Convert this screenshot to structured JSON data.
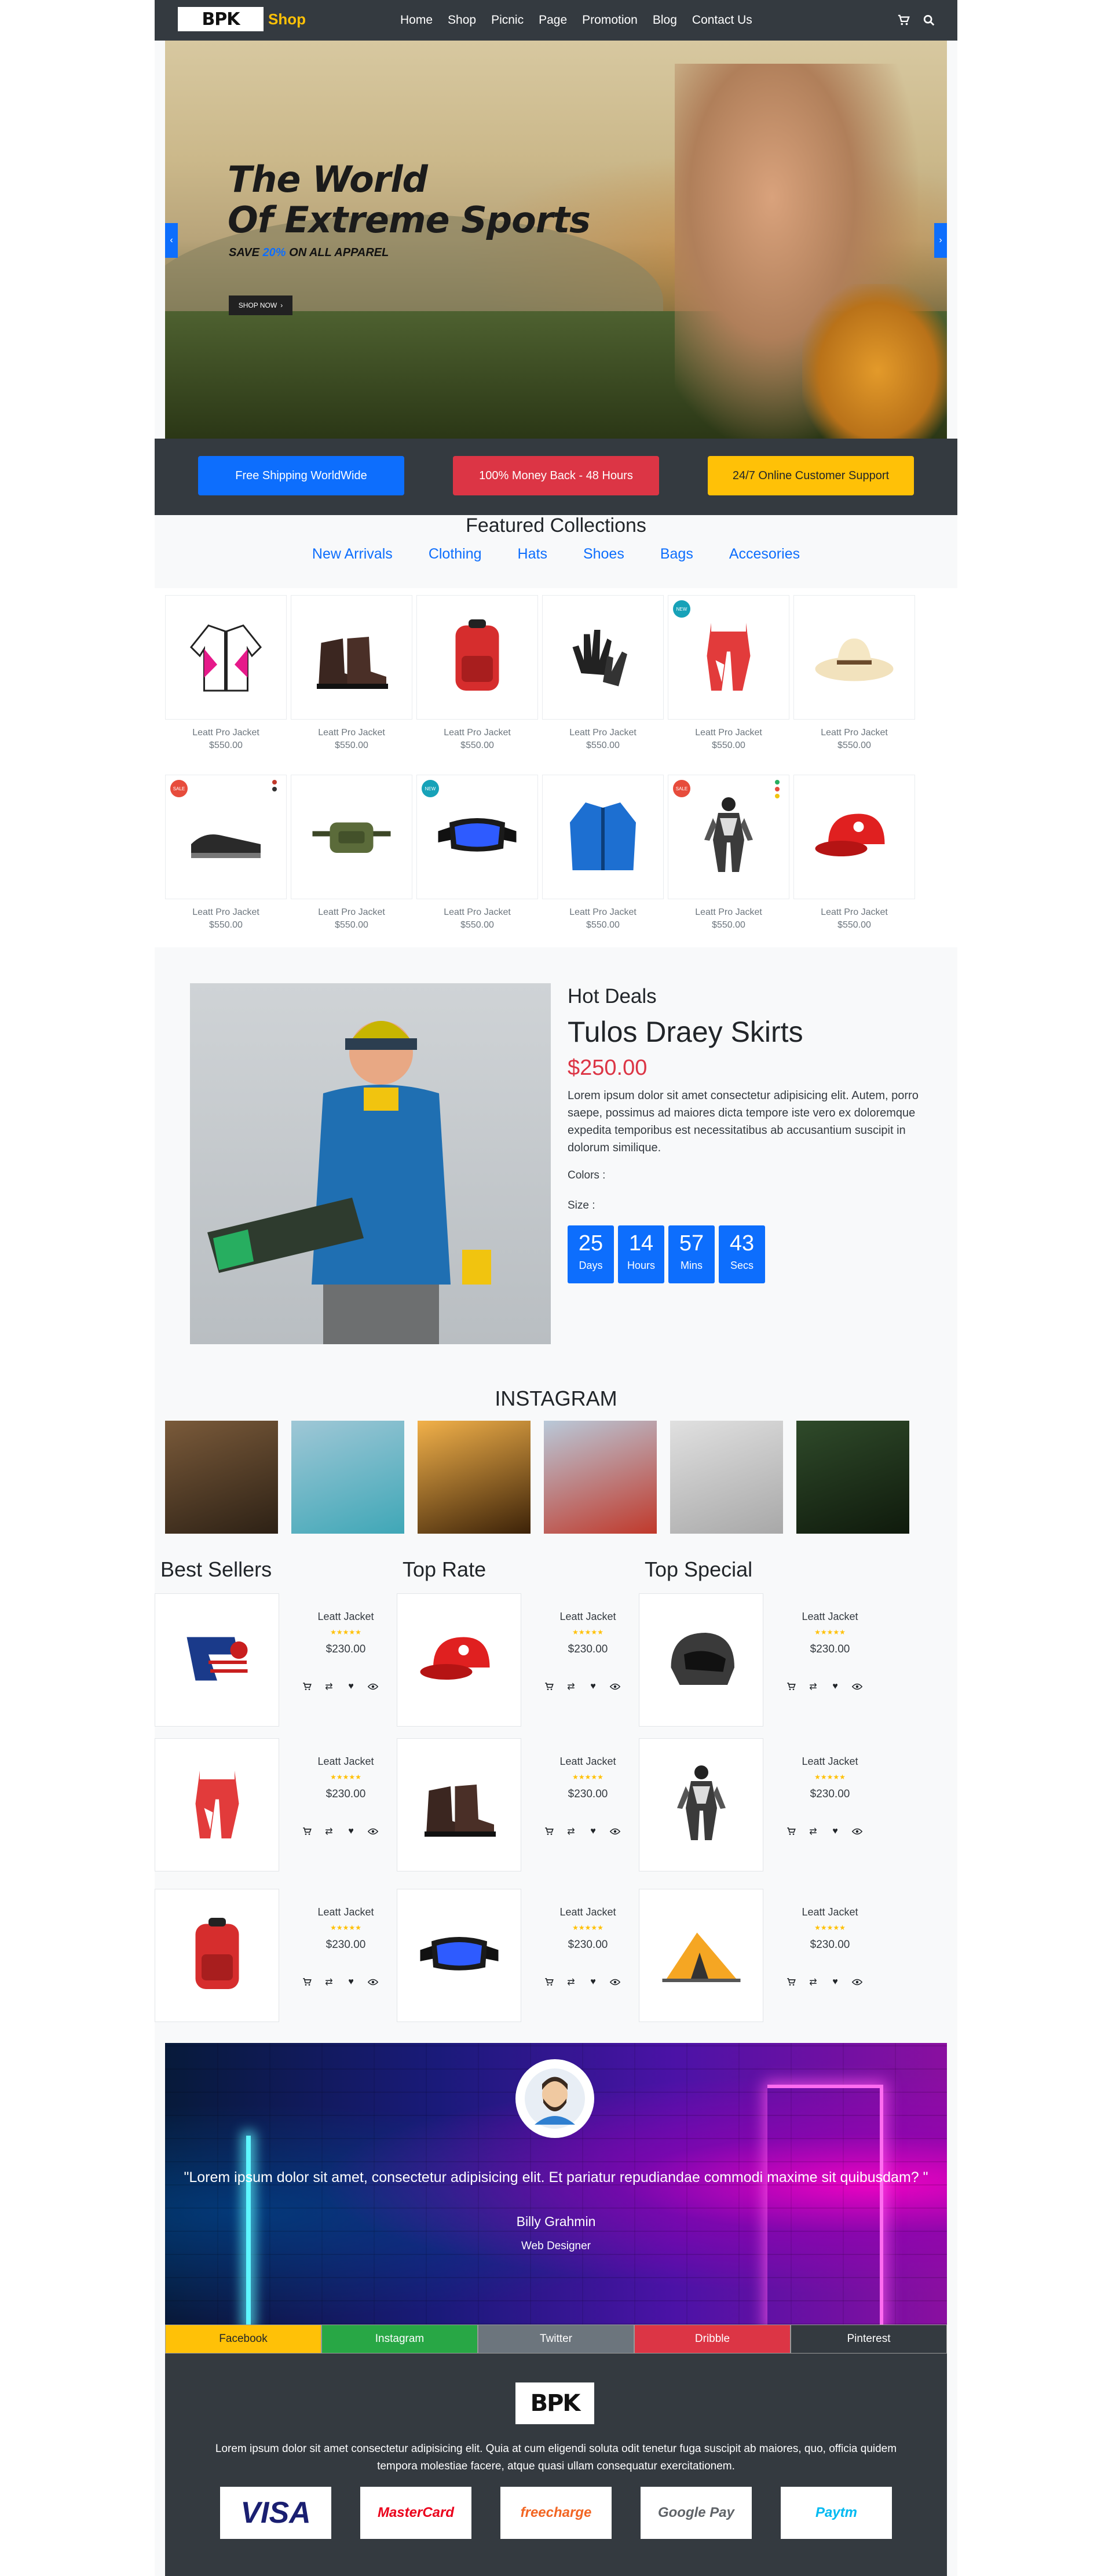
{
  "nav": {
    "logo": "BPK",
    "logo_suffix": "Shop",
    "links": [
      "Home",
      "Shop",
      "Picnic",
      "Page",
      "Promotion",
      "Blog",
      "Contact Us"
    ],
    "icons": [
      "cart-icon",
      "search-icon"
    ]
  },
  "hero": {
    "title_line1": "The World",
    "title_line2": "Of Extreme Sports",
    "save_prefix": "SAVE",
    "save_pct": "20%",
    "save_suffix": "ON ALL APPAREL",
    "cta": "SHOP NOW",
    "cta_icon": "›"
  },
  "features": [
    {
      "label": "Free Shipping WorldWide",
      "color": "#0d6efd"
    },
    {
      "label": "100% Money Back - 48 Hours",
      "color": "#dc3545"
    },
    {
      "label": "24/7 Online Customer Support",
      "color": "#ffc107"
    }
  ],
  "featured": {
    "title": "Featured Collections",
    "tabs": [
      "New Arrivals",
      "Clothing",
      "Hats",
      "Shoes",
      "Bags",
      "Accesories"
    ],
    "products": [
      {
        "name": "Leatt Pro Jacket",
        "price": "$550.00",
        "icon": "jacket"
      },
      {
        "name": "Leatt Pro Jacket",
        "price": "$550.00",
        "icon": "boots"
      },
      {
        "name": "Leatt Pro Jacket",
        "price": "$550.00",
        "icon": "backpack"
      },
      {
        "name": "Leatt Pro Jacket",
        "price": "$550.00",
        "icon": "gloves"
      },
      {
        "name": "Leatt Pro Jacket",
        "price": "$550.00",
        "icon": "pants",
        "badge": "NEW"
      },
      {
        "name": "Leatt Pro Jacket",
        "price": "$550.00",
        "icon": "hat"
      },
      {
        "name": "Leatt Pro Jacket",
        "price": "$550.00",
        "icon": "shoes",
        "badge": "SALE"
      },
      {
        "name": "Leatt Pro Jacket",
        "price": "$550.00",
        "icon": "waistbag"
      },
      {
        "name": "Leatt Pro Jacket",
        "price": "$550.00",
        "icon": "goggles",
        "badge": "NEW"
      },
      {
        "name": "Leatt Pro Jacket",
        "price": "$550.00",
        "icon": "bluejacket"
      },
      {
        "name": "Leatt Pro Jacket",
        "price": "$550.00",
        "icon": "suit",
        "badge": "SALE"
      },
      {
        "name": "Leatt Pro Jacket",
        "price": "$550.00",
        "icon": "cap"
      }
    ]
  },
  "hot": {
    "label": "Hot Deals",
    "title": "Tulos Draey Skirts",
    "price": "$250.00",
    "desc": "Lorem ipsum dolor sit amet consectetur adipisicing elit. Autem, porro saepe, possimus ad maiores dicta tempore iste vero ex doloremque expedita temporibus est necessitatibus ab accusantium suscipit in dolorum similique.",
    "colors_label": "Colors :",
    "size_label": "Size :",
    "countdown": [
      {
        "num": "25",
        "label": "Days"
      },
      {
        "num": "14",
        "label": "Hours"
      },
      {
        "num": "57",
        "label": "Mins"
      },
      {
        "num": "43",
        "label": "Secs"
      }
    ]
  },
  "instagram": {
    "title": "INSTAGRAM",
    "photos": [
      {
        "colors": [
          "#7a5a3a",
          "#2d2115"
        ]
      },
      {
        "colors": [
          "#9fc7d6",
          "#3fa7b7"
        ]
      },
      {
        "colors": [
          "#f2b14a",
          "#3c2208"
        ]
      },
      {
        "colors": [
          "#b9c9d9",
          "#c0392b"
        ]
      },
      {
        "colors": [
          "#e0e0e0",
          "#a8a8a8"
        ]
      },
      {
        "colors": [
          "#2f4a2a",
          "#0f1a0c"
        ]
      }
    ]
  },
  "lists": {
    "titles": [
      "Best Sellers",
      "Top Rate",
      "Top Special"
    ],
    "items": [
      {
        "name": "Leatt Jacket",
        "price": "$230.00",
        "stars": "★★★★★",
        "icon": "flag"
      },
      {
        "name": "Leatt Jacket",
        "price": "$230.00",
        "stars": "★★★★★",
        "icon": "cap"
      },
      {
        "name": "Leatt Jacket",
        "price": "$230.00",
        "stars": "★★★★★",
        "icon": "helmet"
      },
      {
        "name": "Leatt Jacket",
        "price": "$230.00",
        "stars": "★★★★★",
        "icon": "pants"
      },
      {
        "name": "Leatt Jacket",
        "price": "$230.00",
        "stars": "★★★★★",
        "icon": "boots"
      },
      {
        "name": "Leatt Jacket",
        "price": "$230.00",
        "stars": "★★★★★",
        "icon": "suit"
      },
      {
        "name": "Leatt Jacket",
        "price": "$230.00",
        "stars": "★★★★★",
        "icon": "backpack"
      },
      {
        "name": "Leatt Jacket",
        "price": "$230.00",
        "stars": "★★★★★",
        "icon": "goggles"
      },
      {
        "name": "Leatt Jacket",
        "price": "$230.00",
        "stars": "★★★★★",
        "icon": "tent"
      }
    ],
    "actions": [
      "cart-icon",
      "compare-icon",
      "heart-icon",
      "eye-icon"
    ]
  },
  "testimonial": {
    "quote": "\"Lorem ipsum dolor sit amet, consectetur adipisicing elit. Et pariatur repudiandae commodi maxime sit quibusdam? \"",
    "name": "Billy Grahmin",
    "role": "Web Designer"
  },
  "socials": [
    {
      "label": "Facebook",
      "bg": "#ffc107",
      "fg": "#212529"
    },
    {
      "label": "Instagram",
      "bg": "#28a745",
      "fg": "#ffffff"
    },
    {
      "label": "Twitter",
      "bg": "#6c757d",
      "fg": "#ffffff"
    },
    {
      "label": "Dribble",
      "bg": "#dc3545",
      "fg": "#ffffff"
    },
    {
      "label": "Pinterest",
      "bg": "#343a40",
      "fg": "#ffffff"
    }
  ],
  "footer": {
    "logo": "BPK",
    "text": "Lorem ipsum dolor sit amet consectetur adipisicing elit. Quia at cum eligendi soluta odit tenetur fuga suscipit ab maiores, quo, officia quidem tempora molestiae facere, atque quasi ullam consequatur exercitationem.",
    "payments": [
      {
        "label": "VISA",
        "color": "#1a1f71"
      },
      {
        "label": "MasterCard",
        "color": "#eb001b"
      },
      {
        "label": "freecharge",
        "color": "#f26522"
      },
      {
        "label": "Google Pay",
        "color": "#5f6368"
      },
      {
        "label": "Paytm",
        "color": "#00baf2"
      }
    ]
  }
}
